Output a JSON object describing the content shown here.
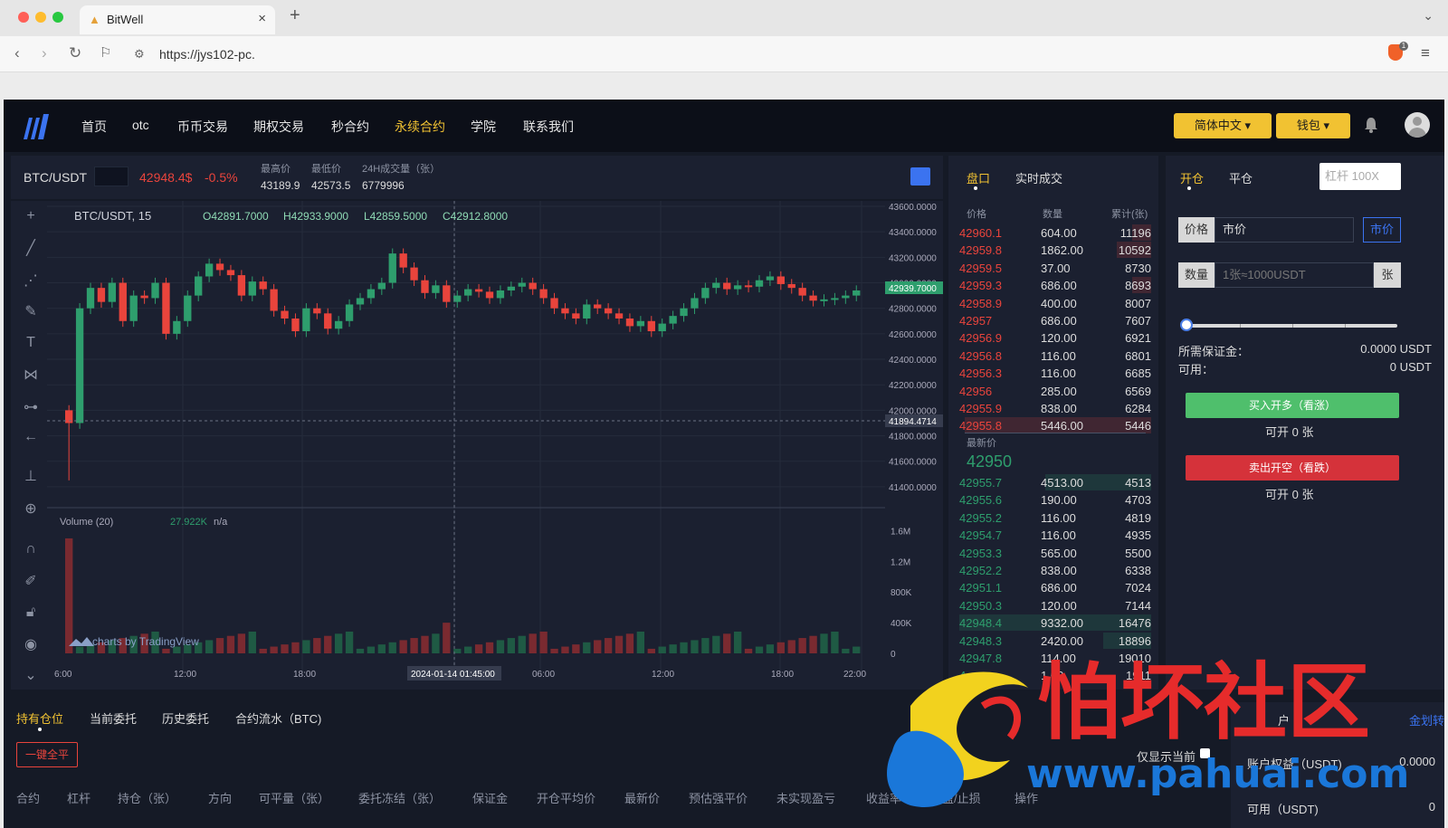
{
  "browser": {
    "tab_title": "BitWell",
    "url": "https://jys102-pc.",
    "extension_badge": "1"
  },
  "nav": {
    "items": [
      {
        "label": "首页",
        "active": false
      },
      {
        "label": "otc",
        "active": false
      },
      {
        "label": "币币交易",
        "active": false
      },
      {
        "label": "期权交易",
        "active": false
      },
      {
        "label": "秒合约",
        "active": false
      },
      {
        "label": "永续合约",
        "active": true
      },
      {
        "label": "学院",
        "active": false
      },
      {
        "label": "联系我们",
        "active": false
      }
    ],
    "language_label": "简体中文",
    "wallet_label": "钱包",
    "accent_color": "#f1c232"
  },
  "ticker": {
    "symbol": "BTC/USDT",
    "last_price": "42948.4$",
    "change": "-0.5%",
    "high_label": "最高价",
    "high": "43189.9",
    "low_label": "最低价",
    "low": "42573.5",
    "vol_label": "24H成交量（张）",
    "vol": "6779996"
  },
  "chart": {
    "legend_symbol": "BTC/USDT, 15",
    "legend_o": "O42891.7000",
    "legend_h": "H42933.9000",
    "legend_l": "L42859.5000",
    "legend_c": "C42912.8000",
    "price_badge": "42939.7000",
    "cross_price": "41894.4714",
    "volume_label": "Volume (20)",
    "volume_value": "27.922K",
    "volume_na": "n/a",
    "watermark": "charts by TradingView",
    "cursor_time": "2024-01-14 01:45:00",
    "price_ticks": [
      "43600.0000",
      "43400.0000",
      "43200.0000",
      "43000.0000",
      "42800.0000",
      "42600.0000",
      "42400.0000",
      "42200.0000",
      "42000.0000",
      "41800.0000",
      "41600.0000",
      "41400.0000"
    ],
    "volume_ticks": [
      "1.6M",
      "1.2M",
      "800K",
      "400K",
      "0"
    ],
    "time_ticks": [
      "6:00",
      "12:00",
      "18:00",
      "06:00",
      "12:00",
      "18:00",
      "22:00"
    ]
  },
  "chart_data": {
    "type": "candlestick",
    "title": "BTC/USDT, 15",
    "ylim": [
      41300,
      43600
    ],
    "volume_ylim": [
      0,
      1700000
    ],
    "up_color": "#2e9e6d",
    "down_color": "#e9443c",
    "close_series": [
      41900,
      42800,
      42960,
      42850,
      43000,
      42700,
      42900,
      42880,
      43000,
      42600,
      42700,
      42900,
      43050,
      43150,
      43100,
      43060,
      42900,
      43010,
      42950,
      42780,
      42720,
      42620,
      42800,
      42760,
      42640,
      42700,
      42830,
      42880,
      42950,
      43000,
      43230,
      43120,
      43020,
      42920,
      42980,
      42850,
      42900,
      42950,
      42930,
      42880,
      42940,
      42970,
      43000,
      42950,
      42880,
      42800,
      42760,
      42720,
      42830,
      42800,
      42760,
      42720,
      42660,
      42700,
      42620,
      42680,
      42740,
      42800,
      42880,
      42960,
      43000,
      42950,
      42980,
      42970,
      43020,
      43050,
      42990,
      42960,
      42900,
      42860,
      42870,
      42880,
      42900,
      42940
    ]
  },
  "orderbook": {
    "tab_book": "盘口",
    "tab_trades": "实时成交",
    "col_price": "价格",
    "col_qty": "数量",
    "col_total": "累计(张)",
    "asks": [
      {
        "price": "42960.1",
        "qty": "604.00",
        "total": "11196",
        "depth": 0.1
      },
      {
        "price": "42959.8",
        "qty": "1862.00",
        "total": "10592",
        "depth": 0.18
      },
      {
        "price": "42959.5",
        "qty": "37.00",
        "total": "8730",
        "depth": 0.0
      },
      {
        "price": "42959.3",
        "qty": "686.00",
        "total": "8693",
        "depth": 0.1
      },
      {
        "price": "42958.9",
        "qty": "400.00",
        "total": "8007",
        "depth": 0.0
      },
      {
        "price": "42957",
        "qty": "686.00",
        "total": "7607",
        "depth": 0.0
      },
      {
        "price": "42956.9",
        "qty": "120.00",
        "total": "6921",
        "depth": 0.0
      },
      {
        "price": "42956.8",
        "qty": "116.00",
        "total": "6801",
        "depth": 0.0
      },
      {
        "price": "42956.3",
        "qty": "116.00",
        "total": "6685",
        "depth": 0.0
      },
      {
        "price": "42956",
        "qty": "285.00",
        "total": "6569",
        "depth": 0.0
      },
      {
        "price": "42955.9",
        "qty": "838.00",
        "total": "6284",
        "depth": 0.0
      },
      {
        "price": "42955.8",
        "qty": "5446.00",
        "total": "5446",
        "depth": 0.97
      }
    ],
    "last_label": "最新价",
    "last_price": "42950",
    "bids": [
      {
        "price": "42955.7",
        "qty": "4513.00",
        "total": "4513",
        "depth": 0.55
      },
      {
        "price": "42955.6",
        "qty": "190.00",
        "total": "4703",
        "depth": 0.0
      },
      {
        "price": "42955.2",
        "qty": "116.00",
        "total": "4819",
        "depth": 0.0
      },
      {
        "price": "42954.7",
        "qty": "116.00",
        "total": "4935",
        "depth": 0.0
      },
      {
        "price": "42953.3",
        "qty": "565.00",
        "total": "5500",
        "depth": 0.0
      },
      {
        "price": "42952.2",
        "qty": "838.00",
        "total": "6338",
        "depth": 0.0
      },
      {
        "price": "42951.1",
        "qty": "686.00",
        "total": "7024",
        "depth": 0.0
      },
      {
        "price": "42950.3",
        "qty": "120.00",
        "total": "7144",
        "depth": 0.0
      },
      {
        "price": "42948.4",
        "qty": "9332.00",
        "total": "16476",
        "depth": 1.0
      },
      {
        "price": "42948.3",
        "qty": "2420.00",
        "total": "18896",
        "depth": 0.25
      },
      {
        "price": "42947.8",
        "qty": "114.00",
        "total": "19010",
        "depth": 0.0
      },
      {
        "price": "4",
        "qty": "1.00",
        "total": "1911",
        "depth": 0.0
      }
    ]
  },
  "trade": {
    "tab_open": "开仓",
    "tab_close": "平仓",
    "leverage_placeholder": "杠杆 100X",
    "price_label": "价格",
    "price_value": "市价",
    "market_btn": "市价",
    "qty_label": "数量",
    "qty_placeholder": "1张≈1000USDT",
    "qty_unit": "张",
    "margin_label": "所需保证金：",
    "margin_value": "0.0000 USDT",
    "avail_label": "可用：",
    "avail_value": "0 USDT",
    "buy_label": "买入开多（看涨）",
    "buy_avail": "可开 0 张",
    "sell_label": "卖出开空（看跌）",
    "sell_avail": "可开 0 张",
    "slider_fraction": 0
  },
  "bottom": {
    "tabs": [
      "持有仓位",
      "当前委托",
      "历史委托",
      "合约流水（BTC)"
    ],
    "close_all": "一键全平",
    "only_current": "仅显示当前",
    "columns": [
      "合约",
      "杠杆",
      "持仓（张）",
      "方向",
      "可平量（张）",
      "委托冻结（张）",
      "保证金",
      "开仓平均价",
      "最新价",
      "预估强平价",
      "未实现盈亏",
      "收益率",
      "止盈/止损",
      "操作"
    ],
    "account_title": "户",
    "fund_transfer": "金划转",
    "equity_label": "账户权益（USDT)",
    "equity_value": "0.0000",
    "available_label": "可用（USDT)",
    "available_value": "0"
  },
  "watermark": {
    "text_cn": "怕坏社区",
    "text_url": "www.pahuai.com"
  }
}
